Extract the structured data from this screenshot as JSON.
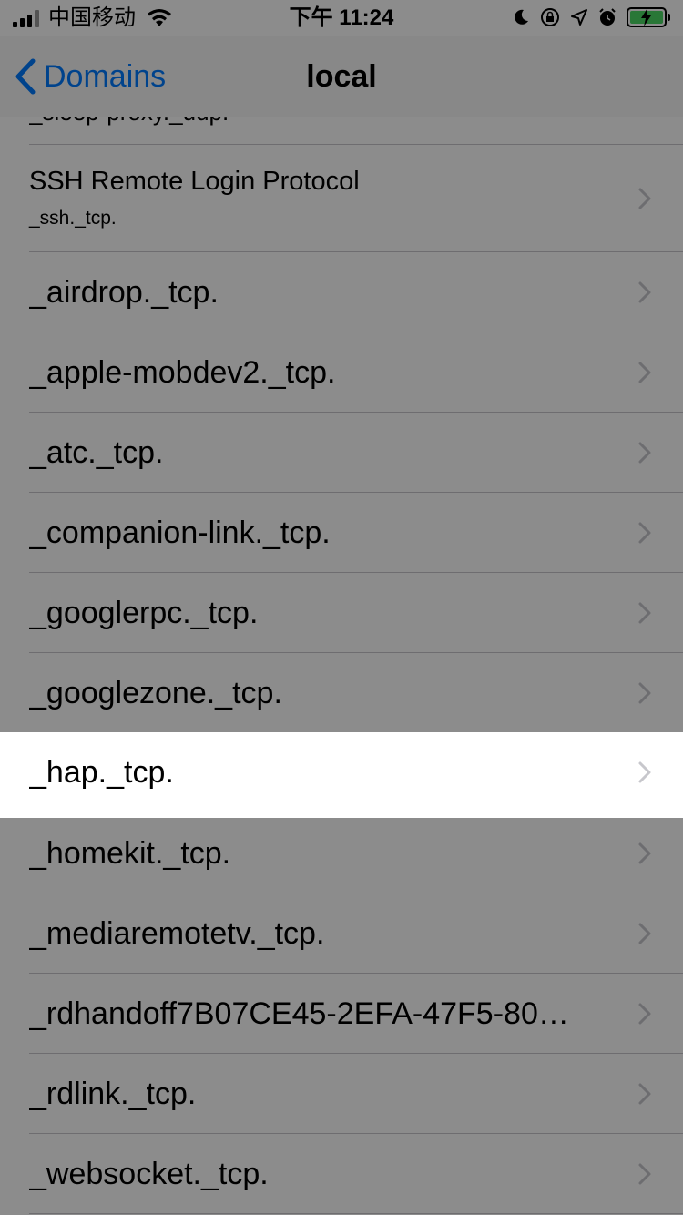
{
  "status_bar": {
    "carrier": "中国移动",
    "time": "下午 11:24",
    "icons": [
      "signal-icon",
      "wifi-icon",
      "moon-icon",
      "orientation-lock-icon",
      "location-icon",
      "alarm-icon",
      "battery-charging-icon"
    ]
  },
  "nav": {
    "back_label": "Domains",
    "title": "local"
  },
  "list": {
    "partial_top": "_sleep-proxy._udp.",
    "ssh": {
      "title": "SSH Remote Login Protocol",
      "subtitle": "_ssh._tcp."
    },
    "items": [
      "_airdrop._tcp.",
      "_apple-mobdev2._tcp.",
      "_atc._tcp.",
      "_companion-link._tcp.",
      "_googlerpc._tcp.",
      "_googlezone._tcp.",
      "_hap._tcp.",
      "_homekit._tcp.",
      "_mediaremotetv._tcp.",
      "_rdhandoff7B07CE45-2EFA-47F5-80…",
      "_rdlink._tcp.",
      "_websocket._tcp."
    ],
    "highlighted_item": "_hap._tcp."
  },
  "colors": {
    "accent": "#007aff",
    "overlay": "rgba(0,0,0,0.45)",
    "battery": "#4cd964"
  }
}
